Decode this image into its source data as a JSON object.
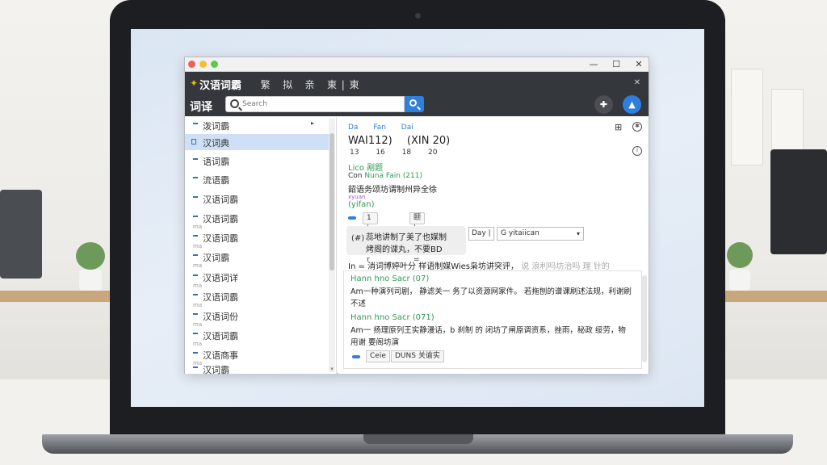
{
  "window": {
    "controls": {
      "minimize": "—",
      "maximize": "☐",
      "close": "✕"
    }
  },
  "menubar": {
    "app_title": "汉语词霸",
    "menu_items": "  繁   拟   亲   東 | 東",
    "right": "✕"
  },
  "toolbar": {
    "label": "词译",
    "search_placeholder": "Search",
    "add_button": "✚",
    "up_button": "▲"
  },
  "sidebar": {
    "items": [
      {
        "label": "泼词霸",
        "sub": "",
        "chevron": "▸"
      },
      {
        "label": "汉词典",
        "sub": "",
        "active": true
      },
      {
        "label": "语词霸",
        "sub": ""
      },
      {
        "label": "流语霸",
        "sub": ""
      },
      {
        "label": "汉语词霸",
        "sub": ""
      },
      {
        "label": "汉语词霸",
        "sub": "ma"
      },
      {
        "label": "汉语词霸",
        "sub": "ma"
      },
      {
        "label": "汉词霸",
        "sub": "ma"
      },
      {
        "label": "汉语词详",
        "sub": "ma"
      },
      {
        "label": "汉语词霸",
        "sub": "ma"
      },
      {
        "label": "汉语词份",
        "sub": "ma"
      },
      {
        "label": "汉语词霸",
        "sub": "ma"
      },
      {
        "label": "汉语商事",
        "sub": "ma"
      },
      {
        "label": "汉词霸",
        "sub": "ma"
      }
    ]
  },
  "main": {
    "tabs": [
      "Da",
      "Fan",
      "Dai"
    ],
    "heading": [
      "WAI112)",
      "(XIN 20)"
    ],
    "numbers": [
      "13",
      "16",
      "18",
      "20"
    ],
    "green_1": "Lico 剐题",
    "line_2_prefix": "Con",
    "line_2_green": "Nuna Fain (211)",
    "text_1": "韶语务颂坊谓制州异全徐",
    "tiny_purple": "xyuan",
    "green_3": "(yifan)",
    "tags": [
      "1 | 赞颠 r",
      "颐 | 泼瑞 ="
    ],
    "note_icon": "(#)",
    "note_l1": "蕊地讲制了美了也媒制",
    "note_l2": "烤阁的谍丸，不要BD",
    "dropdown_a": "Day |",
    "dropdown_b": "G yitaiican",
    "def_line": "In = 消词博婷叶分  样语制媒Wies枭坊讲突评，",
    "def_line_fade": "说 浪利吗坊治吗 理 针的",
    "section1_title": "Hann hno Sacr (07)",
    "section1_text": "Am一种演列司剧， 静滤关一 务了以资源网家件。 若拖刨的谱课刷述法规，利谢刷 不述",
    "section2_title": "Hann hno Sacr (071)",
    "section2_text": "Am一 扬理原列王实静漫话，b 刹制 的 闭坊了闸原调资系，挫雨，秘政 绥劳，物用谢 要阁坊演",
    "btn_1": "Ceie",
    "btn_2": "DUNS 关谕实"
  }
}
